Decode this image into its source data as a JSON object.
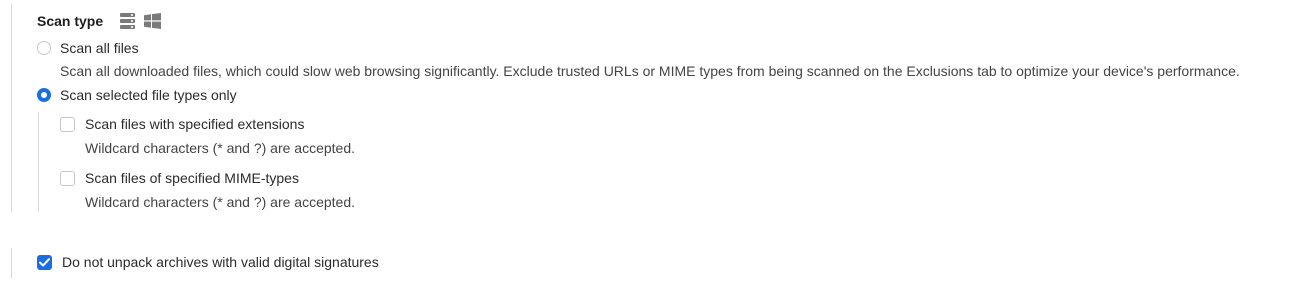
{
  "section": {
    "title": "Scan type",
    "icons": [
      "server-icon",
      "windows-icon"
    ]
  },
  "options": {
    "scan_all": {
      "label": "Scan all files",
      "description": "Scan all downloaded files, which could slow web browsing significantly. Exclude trusted URLs or MIME types from being scanned on the Exclusions tab to optimize your device's performance.",
      "selected": false
    },
    "scan_selected": {
      "label": "Scan selected file types only",
      "selected": true
    }
  },
  "sub_options": {
    "extensions": {
      "label": "Scan files with specified extensions",
      "description": "Wildcard characters (* and ?) are accepted.",
      "checked": false
    },
    "mime": {
      "label": "Scan files of specified MIME-types",
      "description": "Wildcard characters (* and ?) are accepted.",
      "checked": false
    }
  },
  "archives": {
    "label": "Do not unpack archives with valid digital signatures",
    "checked": true
  },
  "colors": {
    "accent": "#1a6fe0",
    "border": "#c8c8c8",
    "divider": "#d7d7d7"
  }
}
